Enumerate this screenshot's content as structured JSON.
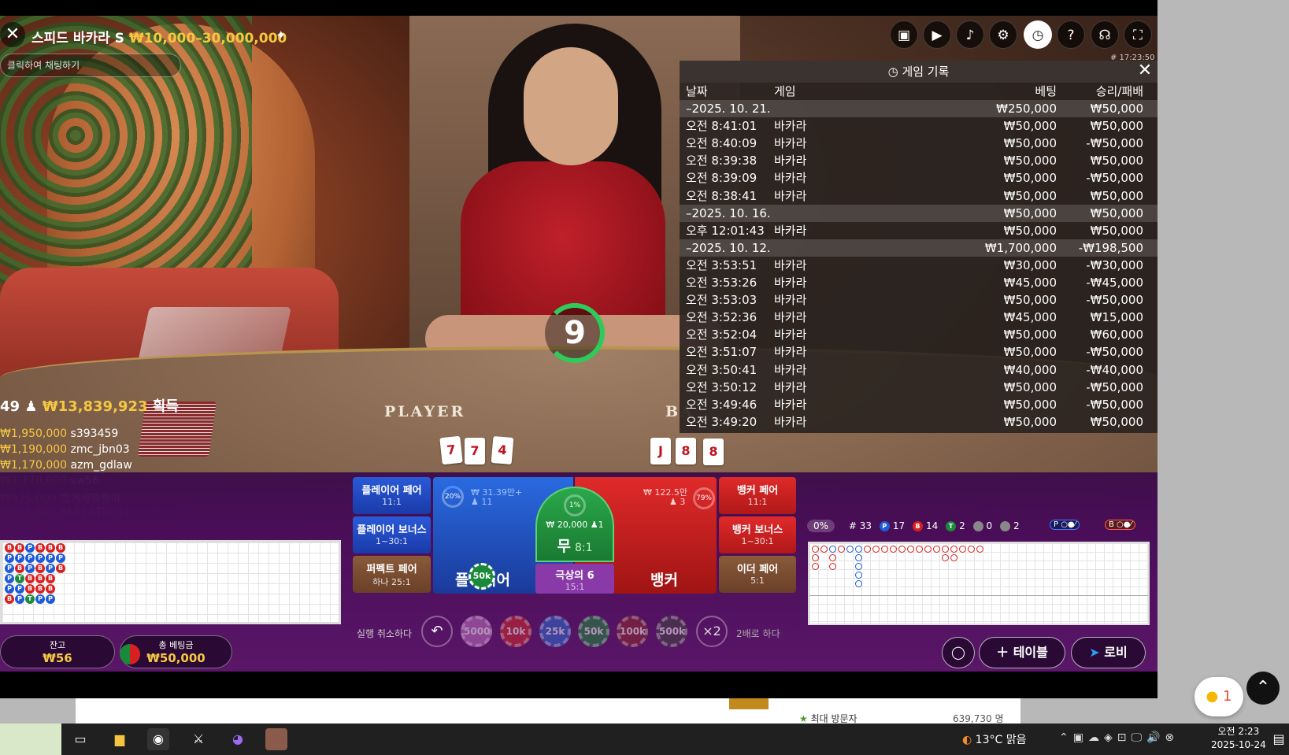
{
  "header": {
    "title": "스피드 바카라 S",
    "limits": "₩10,000–30,000,000",
    "chat_placeholder": "클릭하여 채팅하기",
    "clock": "# 17:23:50"
  },
  "history": {
    "title": "게임 기록",
    "columns": [
      "날짜",
      "게임",
      "베팅",
      "승리/패배"
    ],
    "rows": [
      {
        "type": "date",
        "time": "–2025. 10. 21.",
        "game": "",
        "bet": "₩250,000",
        "win": "₩50,000"
      },
      {
        "type": "row",
        "time": "오전 8:41:01",
        "game": "바카라",
        "bet": "₩50,000",
        "win": "₩50,000"
      },
      {
        "type": "row",
        "time": "오전 8:40:09",
        "game": "바카라",
        "bet": "₩50,000",
        "win": "-₩50,000"
      },
      {
        "type": "row",
        "time": "오전 8:39:38",
        "game": "바카라",
        "bet": "₩50,000",
        "win": "₩50,000"
      },
      {
        "type": "row",
        "time": "오전 8:39:09",
        "game": "바카라",
        "bet": "₩50,000",
        "win": "-₩50,000"
      },
      {
        "type": "row",
        "time": "오전 8:38:41",
        "game": "바카라",
        "bet": "₩50,000",
        "win": "₩50,000"
      },
      {
        "type": "date",
        "time": "–2025. 10. 16.",
        "game": "",
        "bet": "₩50,000",
        "win": "₩50,000"
      },
      {
        "type": "row",
        "time": "오후 12:01:43",
        "game": "바카라",
        "bet": "₩50,000",
        "win": "₩50,000"
      },
      {
        "type": "date",
        "time": "–2025. 10. 12.",
        "game": "",
        "bet": "₩1,700,000",
        "win": "-₩198,500"
      },
      {
        "type": "row",
        "time": "오전 3:53:51",
        "game": "바카라",
        "bet": "₩30,000",
        "win": "-₩30,000"
      },
      {
        "type": "row",
        "time": "오전 3:53:26",
        "game": "바카라",
        "bet": "₩45,000",
        "win": "-₩45,000"
      },
      {
        "type": "row",
        "time": "오전 3:53:03",
        "game": "바카라",
        "bet": "₩50,000",
        "win": "-₩50,000"
      },
      {
        "type": "row",
        "time": "오전 3:52:36",
        "game": "바카라",
        "bet": "₩45,000",
        "win": "₩15,000"
      },
      {
        "type": "row",
        "time": "오전 3:52:04",
        "game": "바카라",
        "bet": "₩50,000",
        "win": "₩60,000"
      },
      {
        "type": "row",
        "time": "오전 3:51:07",
        "game": "바카라",
        "bet": "₩50,000",
        "win": "-₩50,000"
      },
      {
        "type": "row",
        "time": "오전 3:50:41",
        "game": "바카라",
        "bet": "₩40,000",
        "win": "-₩40,000"
      },
      {
        "type": "row",
        "time": "오전 3:50:12",
        "game": "바카라",
        "bet": "₩50,000",
        "win": "-₩50,000"
      },
      {
        "type": "row",
        "time": "오전 3:49:46",
        "game": "바카라",
        "bet": "₩50,000",
        "win": "-₩50,000"
      },
      {
        "type": "row",
        "time": "오전 3:49:20",
        "game": "바카라",
        "bet": "₩50,000",
        "win": "₩50,000"
      }
    ]
  },
  "timer": "9",
  "table_words": {
    "player": "PLAYER",
    "banker": "BA"
  },
  "winners": {
    "count": "49",
    "total": "₩13,839,923",
    "suffix": "획득",
    "list": [
      {
        "amount": "₩1,950,000",
        "name": "s393459"
      },
      {
        "amount": "₩1,190,000",
        "name": "zmc_jbn03"
      },
      {
        "amount": "₩1,170,000",
        "name": "azm_gdlaw"
      },
      {
        "amount": "₩1,170,000",
        "name": "sw56"
      },
      {
        "amount": "₩975,000",
        "name": "벗겨세워빨아"
      },
      {
        "amount": "₩838,500",
        "name": "665167bird1"
      }
    ]
  },
  "bets": {
    "player_pair": {
      "label": "플레이어 페어",
      "odds": "11:1"
    },
    "player_bonus": {
      "label": "플레이어 보너스",
      "odds": "1~30:1"
    },
    "perfect_pair": {
      "label": "퍼펙트 페어",
      "odds": "하나 25:1"
    },
    "banker_pair": {
      "label": "뱅커 페어",
      "odds": "11:1"
    },
    "banker_bonus": {
      "label": "뱅커 보너스",
      "odds": "1~30:1"
    },
    "either_pair": {
      "label": "이더 페어",
      "odds": "5:1"
    },
    "player": {
      "label": "플레이어",
      "pct": "20%",
      "amount": "₩ 31.39만+",
      "players": "11",
      "chip": "50k"
    },
    "banker": {
      "label": "뱅커",
      "pct": "79%",
      "amount": "₩ 122.5만",
      "players": "3"
    },
    "tie": {
      "label": "무",
      "odds": "8:1",
      "pct": "1%",
      "amount": "₩ 20,000",
      "players": "1"
    },
    "super_six": {
      "label": "극상의 6",
      "odds": "15:1"
    }
  },
  "controls": {
    "undo_label": "실행 취소하다",
    "double_label": "2배로 하다",
    "double_icon": "×2",
    "chips": [
      "5000",
      "10k",
      "25k",
      "50k",
      "100k",
      "500k"
    ]
  },
  "balance": {
    "label": "잔고",
    "value": "₩56"
  },
  "total_bet": {
    "label": "총 베팅금",
    "value": "₩50,000"
  },
  "stats": {
    "pct": "0%",
    "rounds": "# 33",
    "player": "17",
    "banker": "14",
    "tie": "2",
    "p_pair": "0",
    "b_pair": "2"
  },
  "nav": {
    "tables": "테이블",
    "lobby": "로비"
  },
  "page_behind": {
    "visitor_label": "최대 방문자",
    "visitor_count": "639,730 명"
  },
  "side_chat_count": "1",
  "taskbar": {
    "weather": "13°C 맑음",
    "time": "오전 2:23",
    "date": "2025-10-24"
  },
  "colors": {
    "gold": "#f5c842",
    "player": "#1f5bd8",
    "banker": "#d82020",
    "tie": "#1a8a3a",
    "purple": "#4a0e58"
  }
}
